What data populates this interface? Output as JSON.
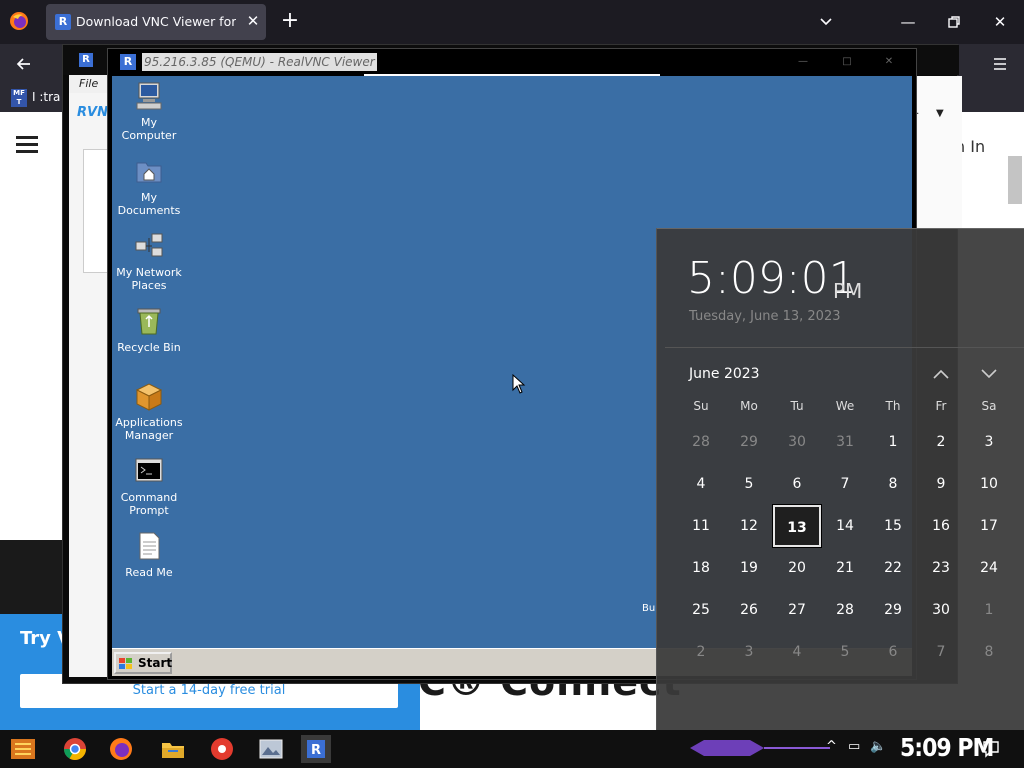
{
  "browser": {
    "tab_title": "Download VNC Viewer for Wi",
    "tab_icon_letter": "R",
    "bookmark_label": "I :tra",
    "bookmark_icon": "MF T"
  },
  "webpage": {
    "signin_text": "n In",
    "promo_title": "Try V",
    "trial_button": "Start a 14-day free trial",
    "heading_fragment": "C® Connect",
    "vnc_logo": "RVNC"
  },
  "vnc_outer": {
    "menu_file": "File"
  },
  "vnc_inner": {
    "title": "95.216.3.85 (QEMU) - RealVNC Viewer"
  },
  "desktop": {
    "icons": [
      {
        "label": "My Computer",
        "icon": "my-computer-icon"
      },
      {
        "label": "My Documents",
        "icon": "my-documents-icon"
      },
      {
        "label": "My Network Places",
        "icon": "network-places-icon"
      },
      {
        "label": "Recycle Bin",
        "icon": "recycle-bin-icon"
      },
      {
        "label": "Applications Manager",
        "icon": "applications-manager-icon"
      },
      {
        "label": "Command Prompt",
        "icon": "command-prompt-icon"
      },
      {
        "label": "Read Me",
        "icon": "read-me-icon"
      }
    ],
    "corner_text": "Bu",
    "start_label": "Start"
  },
  "flyout": {
    "time": "5:09:01",
    "ampm": "PM",
    "date_long": "Tuesday, June 13, 2023",
    "month_label": "June 2023",
    "weekdays": [
      "Su",
      "Mo",
      "Tu",
      "We",
      "Th",
      "Fr",
      "Sa"
    ],
    "weeks": [
      [
        "28",
        "29",
        "30",
        "31",
        "1",
        "2",
        "3"
      ],
      [
        "4",
        "5",
        "6",
        "7",
        "8",
        "9",
        "10"
      ],
      [
        "11",
        "12",
        "13",
        "14",
        "15",
        "16",
        "17"
      ],
      [
        "18",
        "19",
        "20",
        "21",
        "22",
        "23",
        "24"
      ],
      [
        "25",
        "26",
        "27",
        "28",
        "29",
        "30",
        "1"
      ],
      [
        "2",
        "3",
        "4",
        "5",
        "6",
        "7",
        "8"
      ]
    ],
    "today": "13"
  },
  "taskbar": {
    "clock": "5:09 PM",
    "pinned": [
      "start-icon",
      "chrome-icon",
      "firefox-icon",
      "file-explorer-icon",
      "paint-icon",
      "image-app-icon",
      "realvnc-icon"
    ]
  },
  "colors": {
    "desktop_blue": "#3a6ea5",
    "promo_blue": "#2a8de0",
    "flyout_bg": "#3a3a3a"
  }
}
